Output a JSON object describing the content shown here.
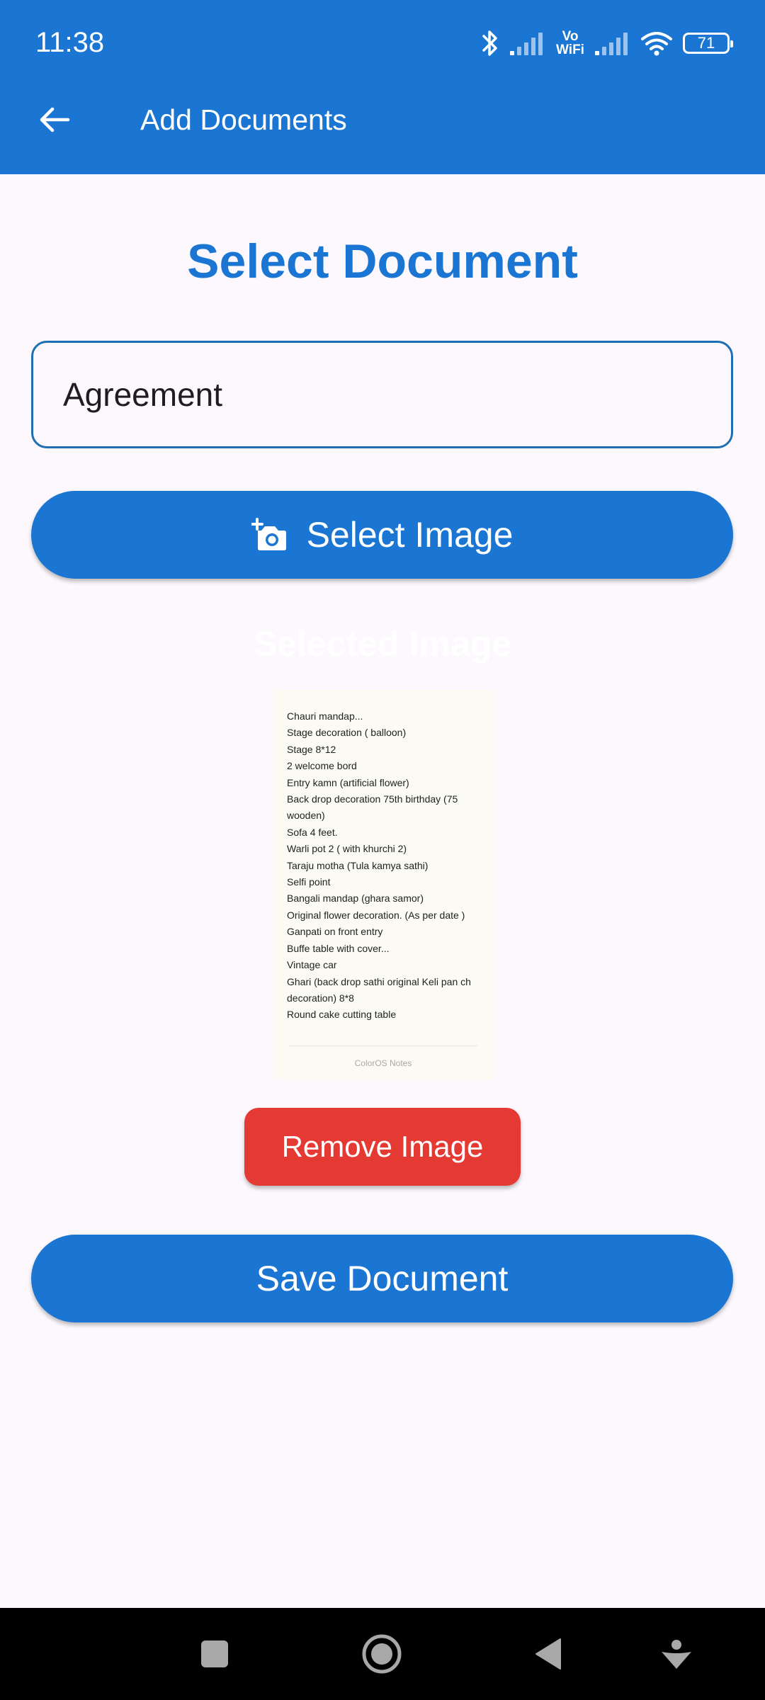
{
  "status_bar": {
    "time": "11:38",
    "vowifi_top": "Vo",
    "vowifi_bottom": "WiFi",
    "battery": "71",
    "icons": [
      "bluetooth-icon",
      "cell-signal-icon",
      "vowifi-icon",
      "cell-signal-icon",
      "wifi-icon",
      "battery-icon"
    ]
  },
  "app_bar": {
    "title": "Add Documents",
    "back_icon": "arrow-back-icon"
  },
  "main": {
    "heading": "Select Document",
    "document_field": {
      "value": "Agreement"
    },
    "select_image_button": {
      "label": "Select Image",
      "icon": "add-a-photo-icon"
    },
    "selected_image_label": "Selected Image",
    "preview": {
      "lines": [
        "Chauri mandap...",
        "Stage decoration ( balloon)",
        "Stage 8*12",
        "2 welcome bord",
        "Entry kamn (artificial flower)",
        "Back drop  decoration 75th birthday (75",
        "wooden)",
        "Sofa 4 feet.",
        "Warli pot 2 ( with khurchi 2)",
        "Taraju motha (Tula kamya sathi)",
        "Selfi point",
        "Bangali mandap (ghara samor)",
        "Original flower decoration. (As per date )",
        "Ganpati on front entry",
        "Buffe table with cover...",
        "Vintage car",
        "Ghari (back drop sathi original Keli pan ch",
        "decoration) 8*8",
        "Round cake cutting table"
      ],
      "footer": "ColorOS Notes"
    },
    "remove_image_button": {
      "label": "Remove Image"
    },
    "save_button": {
      "label": "Save Document"
    }
  },
  "nav_bar": {
    "items": [
      "recents-square-icon",
      "home-circle-icon",
      "back-triangle-icon",
      "assistant-icon"
    ]
  },
  "colors": {
    "primary": "#1a76d2",
    "danger": "#e53934",
    "background": "#fcf8fd",
    "field_border": "#1f6fb4"
  }
}
